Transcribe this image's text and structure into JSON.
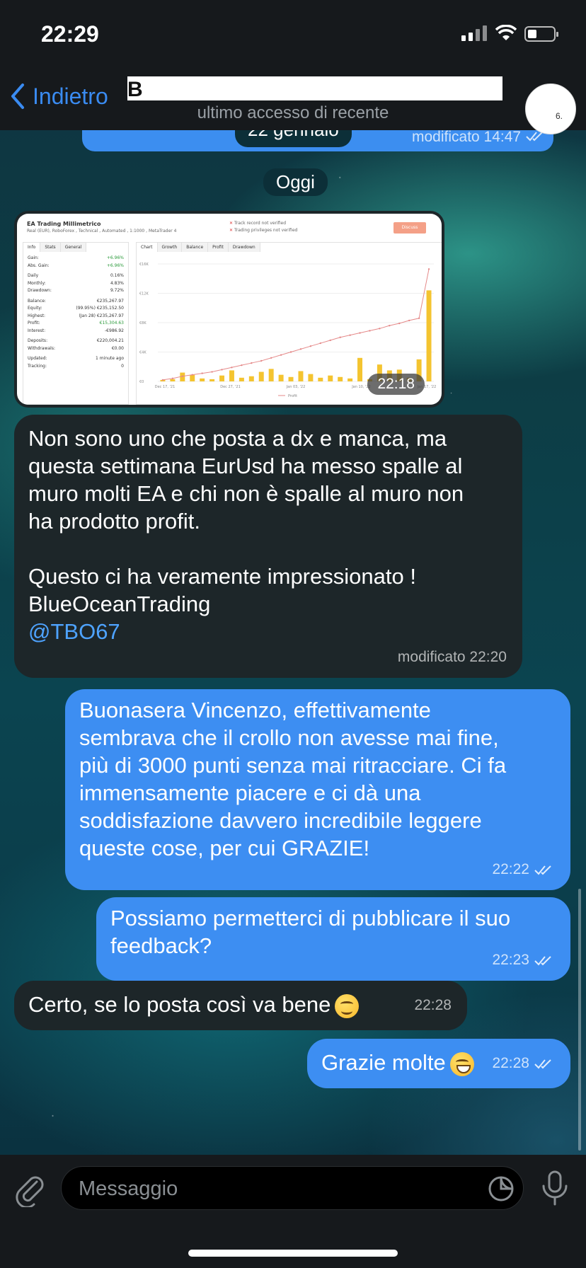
{
  "status": {
    "time": "22:29"
  },
  "header": {
    "back_label": "Indietro",
    "contact_name_visible": "B",
    "subtitle": "ultimo accesso di recente",
    "avatar_text": "6."
  },
  "previous": {
    "date_chip": "22 gennaio",
    "meta": "modificato 14:47"
  },
  "today_chip": "Oggi",
  "photo": {
    "time": "22:18",
    "title": "EA Trading Millimetrico",
    "subtitle": "Real (EUR), RoboForex , Technical , Automated , 1:1000 , MetaTrader 4",
    "warnings": [
      "Track record not verified",
      "Trading privileges not verified"
    ],
    "button": "Discuss",
    "left_tabs": [
      "Info",
      "Stats",
      "General"
    ],
    "stats": [
      {
        "label": "Gain:",
        "value": "+6.96%",
        "positive": true
      },
      {
        "label": "Abs. Gain:",
        "value": "+6.96%",
        "positive": true
      },
      {
        "label": "Daily",
        "value": "0.16%"
      },
      {
        "label": "Monthly:",
        "value": "4.83%"
      },
      {
        "label": "Drawdown:",
        "value": "9.72%"
      },
      {
        "label": "Balance:",
        "value": "€235,267.97"
      },
      {
        "label": "Equity:",
        "value": "(99.95%) €235,152.50"
      },
      {
        "label": "Highest:",
        "value": "(Jan 28) €235,267.97"
      },
      {
        "label": "Profit:",
        "value": "€15,304.63",
        "positive": true
      },
      {
        "label": "Interest:",
        "value": "-€986.92"
      },
      {
        "label": "Deposits:",
        "value": "€220,004.21"
      },
      {
        "label": "Withdrawals:",
        "value": "€0.00"
      },
      {
        "label": "Updated:",
        "value": "1 minute ago"
      },
      {
        "label": "Tracking:",
        "value": "0"
      }
    ],
    "right_tabs": [
      "Chart",
      "Growth",
      "Balance",
      "Profit",
      "Drawdown"
    ]
  },
  "chart_data": {
    "type": "bar",
    "x_labels": [
      "Dec 17, '21",
      "Dec 27, '21",
      "Jan 03, '22",
      "Jan 10, '22",
      "Jan 17, '22"
    ],
    "y_ticks": [
      "€16K",
      "€12K",
      "€8K",
      "€4K",
      "€0"
    ],
    "ylim": [
      0,
      16000
    ],
    "legend": "Profit",
    "bars": [
      200,
      300,
      1200,
      900,
      400,
      300,
      800,
      1500,
      500,
      700,
      1300,
      1700,
      900,
      600,
      1400,
      1000,
      500,
      800,
      600,
      400,
      3200,
      300,
      2300,
      1500,
      1600,
      500,
      3000,
      12400
    ],
    "line": [
      200,
      400,
      700,
      900,
      1100,
      1300,
      1600,
      1900,
      2200,
      2500,
      2800,
      3200,
      3600,
      4000,
      4400,
      4800,
      5200,
      5600,
      6000,
      6300,
      6600,
      6900,
      7200,
      7600,
      7900,
      8300,
      8600,
      15300
    ]
  },
  "messages": [
    {
      "lines": [
        "Non sono uno che posta a dx e manca, ma",
        "questa settimana EurUsd ha messo spalle al",
        "muro molti EA e chi non è spalle al muro non",
        "ha prodotto profit.",
        "",
        "Questo ci ha veramente impressionato !",
        "BlueOceanTrading"
      ],
      "mention": "@TBO67",
      "meta": "modificato 22:20"
    },
    {
      "lines": [
        "Buonasera Vincenzo, effettivamente",
        "sembrava che il crollo non avesse mai fine,",
        "più di 3000 punti senza mai ritracciare. Ci fa",
        "immensamente piacere e ci dà una",
        "soddisfazione davvero incredibile leggere",
        "queste cose, per cui GRAZIE!"
      ],
      "meta": "22:22"
    },
    {
      "lines": [
        "Possiamo permetterci di pubblicare il suo",
        "feedback?"
      ],
      "meta": "22:23"
    },
    {
      "text": "Certo, se lo posta così va bene",
      "meta": "22:28"
    },
    {
      "text": "Grazie molte",
      "meta": "22:28"
    }
  ],
  "composer": {
    "placeholder": "Messaggio"
  }
}
